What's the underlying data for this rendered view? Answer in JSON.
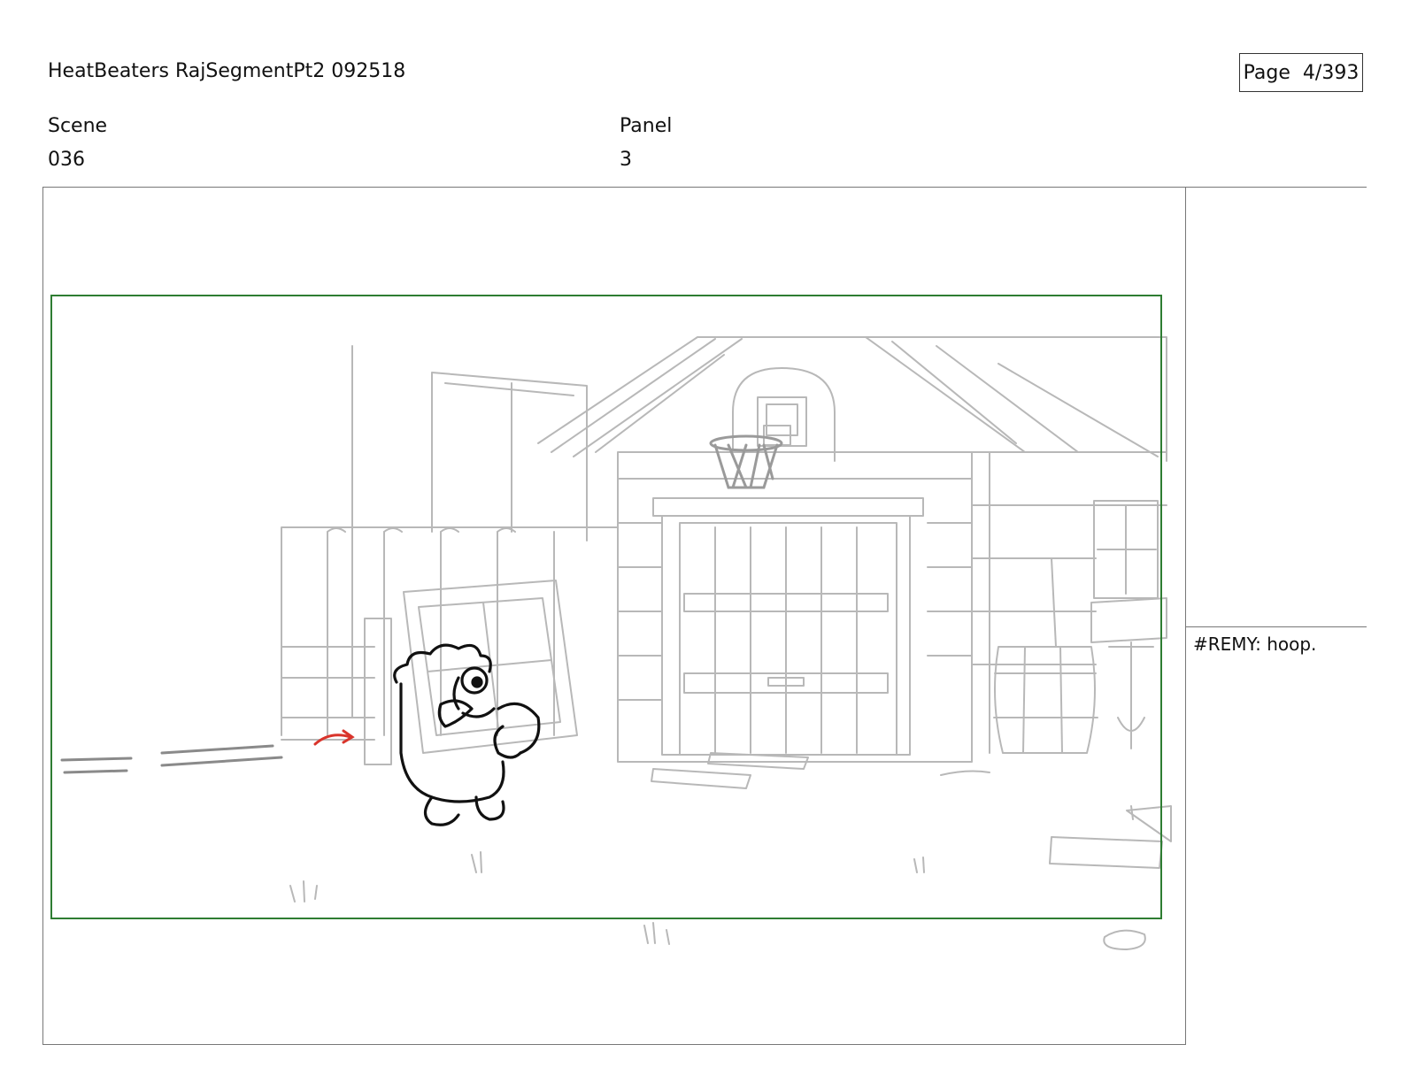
{
  "header": {
    "title": "HeatBeaters RajSegmentPt2 092518",
    "page_label": "Page",
    "page_value": "4/393"
  },
  "fields": {
    "scene_label": "Scene",
    "scene_value": "036",
    "panel_label": "Panel",
    "panel_value": "3"
  },
  "notes": {
    "dialogue": "#REMY: hoop."
  },
  "colors": {
    "safe_frame": "#2e7d32",
    "direction_arrow": "#d9342b",
    "sketch_line": "#b8b8b8",
    "character_line": "#111111"
  }
}
